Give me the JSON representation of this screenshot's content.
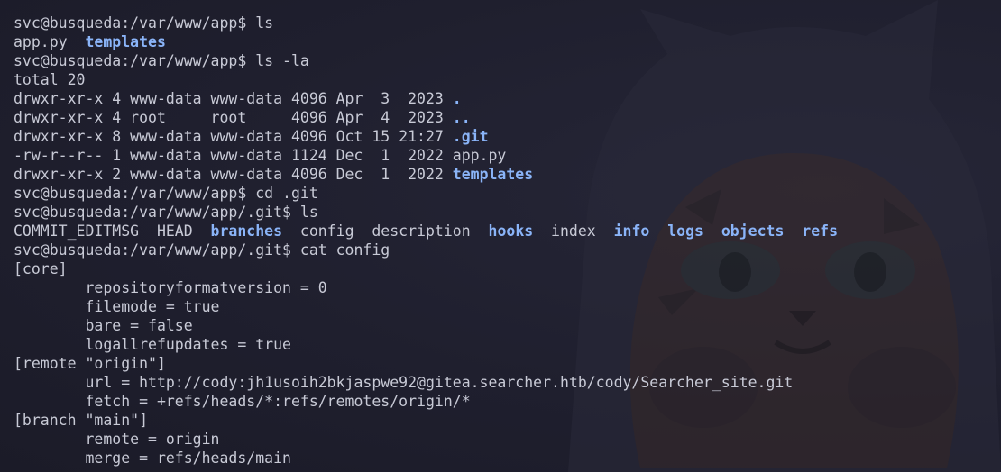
{
  "terminal": {
    "lines": [
      [
        {
          "t": "svc@busqueda:/var/www/app$ ls",
          "c": "prompt"
        }
      ],
      [
        {
          "t": "app.py  "
        },
        {
          "t": "templates",
          "c": "dir"
        }
      ],
      [
        {
          "t": "svc@busqueda:/var/www/app$ ls -la",
          "c": "prompt"
        }
      ],
      [
        {
          "t": "total 20"
        }
      ],
      [
        {
          "t": "drwxr-xr-x 4 www-data www-data 4096 Apr  3  2023 "
        },
        {
          "t": ".",
          "c": "dir"
        }
      ],
      [
        {
          "t": "drwxr-xr-x 4 root     root     4096 Apr  4  2023 "
        },
        {
          "t": "..",
          "c": "dir"
        }
      ],
      [
        {
          "t": "drwxr-xr-x 8 www-data www-data 4096 Oct 15 21:27 "
        },
        {
          "t": ".git",
          "c": "dir"
        }
      ],
      [
        {
          "t": "-rw-r--r-- 1 www-data www-data 1124 Dec  1  2022 app.py"
        }
      ],
      [
        {
          "t": "drwxr-xr-x 2 www-data www-data 4096 Dec  1  2022 "
        },
        {
          "t": "templates",
          "c": "dir"
        }
      ],
      [
        {
          "t": "svc@busqueda:/var/www/app$ cd .git",
          "c": "prompt"
        }
      ],
      [
        {
          "t": "svc@busqueda:/var/www/app/.git$ ls",
          "c": "prompt"
        }
      ],
      [
        {
          "t": "COMMIT_EDITMSG  HEAD  "
        },
        {
          "t": "branches",
          "c": "dir"
        },
        {
          "t": "  config  description  "
        },
        {
          "t": "hooks",
          "c": "dir"
        },
        {
          "t": "  index  "
        },
        {
          "t": "info",
          "c": "dir"
        },
        {
          "t": "  "
        },
        {
          "t": "logs",
          "c": "dir"
        },
        {
          "t": "  "
        },
        {
          "t": "objects",
          "c": "dir"
        },
        {
          "t": "  "
        },
        {
          "t": "refs",
          "c": "dir"
        }
      ],
      [
        {
          "t": "svc@busqueda:/var/www/app/.git$ cat config",
          "c": "prompt"
        }
      ],
      [
        {
          "t": "[core]"
        }
      ],
      [
        {
          "t": "        repositoryformatversion = 0"
        }
      ],
      [
        {
          "t": "        filemode = true"
        }
      ],
      [
        {
          "t": "        bare = false"
        }
      ],
      [
        {
          "t": "        logallrefupdates = true"
        }
      ],
      [
        {
          "t": "[remote \"origin\"]"
        }
      ],
      [
        {
          "t": "        url = http://cody:jh1usoih2bkjaspwe92@gitea.searcher.htb/cody/Searcher_site.git"
        }
      ],
      [
        {
          "t": "        fetch = +refs/heads/*:refs/remotes/origin/*"
        }
      ],
      [
        {
          "t": "[branch \"main\"]"
        }
      ],
      [
        {
          "t": "        remote = origin"
        }
      ],
      [
        {
          "t": "        merge = refs/heads/main"
        }
      ]
    ]
  },
  "colors": {
    "background": "#1e1e2c",
    "text": "#c8cad6",
    "directory": "#8ab4f8"
  },
  "wallpaper": {
    "icon": "cat-mascot-icon"
  }
}
